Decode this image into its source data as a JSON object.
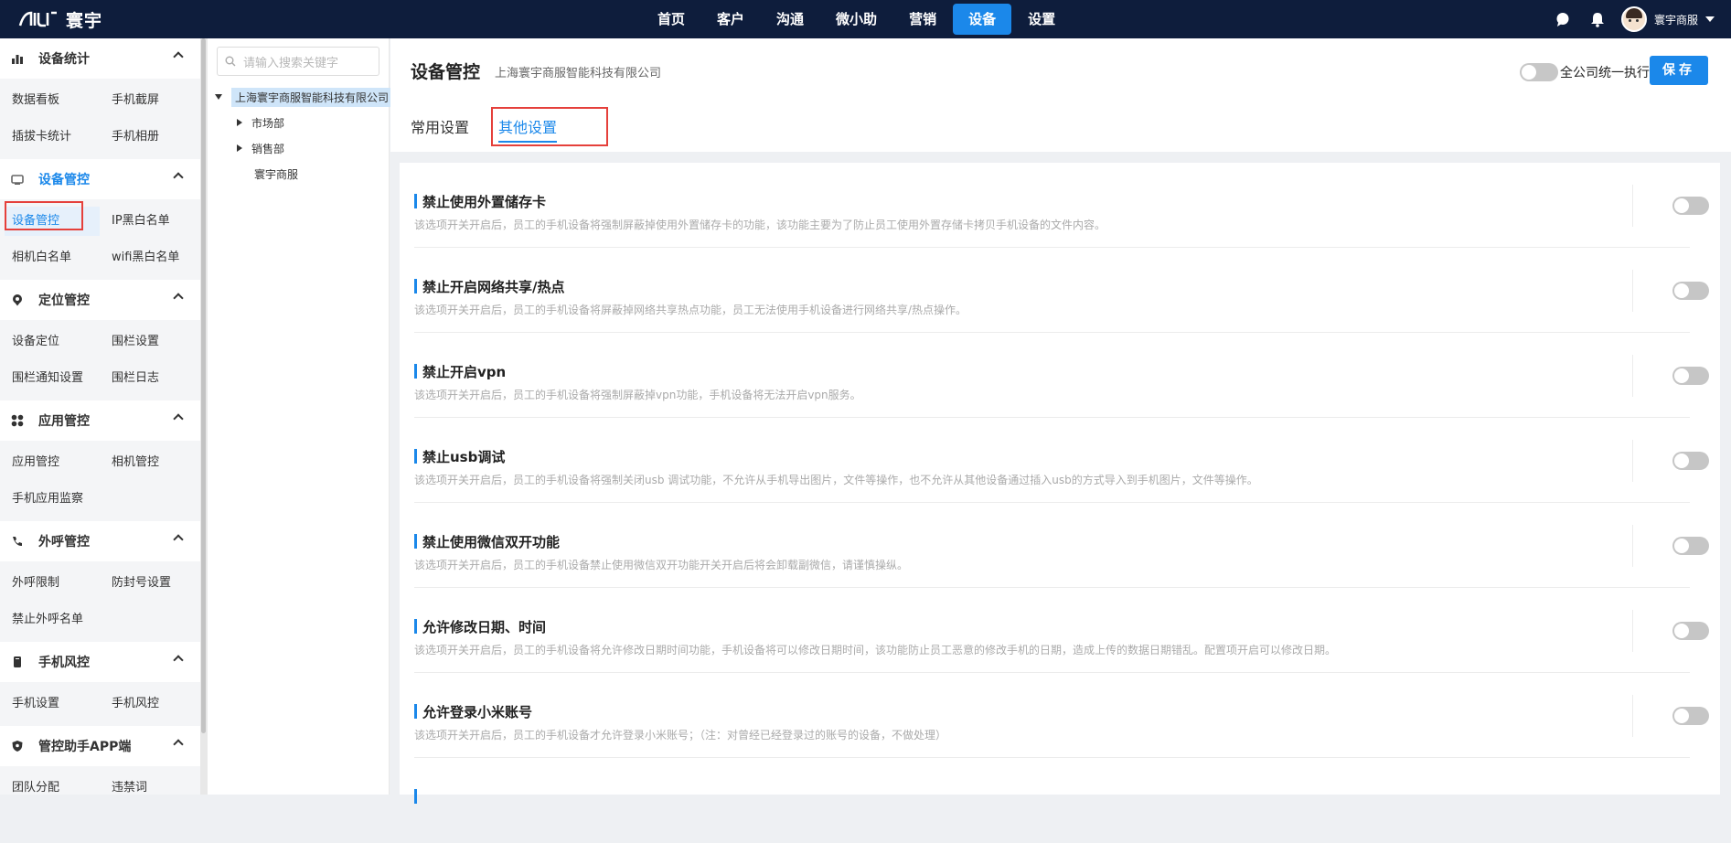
{
  "brand": {
    "name": "寰宇"
  },
  "topnav": [
    {
      "label": "首页"
    },
    {
      "label": "客户"
    },
    {
      "label": "沟通"
    },
    {
      "label": "微小助"
    },
    {
      "label": "营销"
    },
    {
      "label": "设备",
      "active": true
    },
    {
      "label": "设置"
    }
  ],
  "user": {
    "name": "寰宇商服"
  },
  "sidebar": {
    "sections": [
      {
        "title": "设备统计",
        "icon": "bar-chart-icon",
        "items": [
          "数据看板",
          "手机截屏",
          "插拔卡统计",
          "手机相册"
        ]
      },
      {
        "title": "设备管控",
        "icon": "device-icon",
        "items": [
          "设备管控",
          "IP黑白名单",
          "相机白名单",
          "wifi黑白名单"
        ]
      },
      {
        "title": "定位管控",
        "icon": "location-pin-icon",
        "items": [
          "设备定位",
          "围栏设置",
          "围栏通知设置",
          "围栏日志"
        ]
      },
      {
        "title": "应用管控",
        "icon": "apps-grid-icon",
        "items": [
          "应用管控",
          "相机管控",
          "手机应用监察"
        ]
      },
      {
        "title": "外呼管控",
        "icon": "phone-icon",
        "items": [
          "外呼限制",
          "防封号设置",
          "禁止外呼名单"
        ]
      },
      {
        "title": "手机风控",
        "icon": "mobile-icon",
        "items": [
          "手机设置",
          "手机风控"
        ]
      },
      {
        "title": "管控助手APP端",
        "icon": "shield-icon",
        "items": [
          "团队分配",
          "违禁词"
        ]
      }
    ]
  },
  "tree": {
    "search_placeholder": "请输入搜索关键字",
    "root": "上海寰宇商服智能科技有限公司",
    "children": [
      "市场部",
      "销售部",
      "寰宇商服"
    ]
  },
  "main": {
    "title": "设备管控",
    "company": "上海寰宇商服智能科技有限公司",
    "global_toggle_label": "全公司统一执行",
    "save_label": "保存",
    "tabs": [
      "常用设置",
      "其他设置"
    ],
    "active_tab": 1,
    "settings": [
      {
        "title": "禁止使用外置储存卡",
        "desc": "该选项开关开启后，员工的手机设备将强制屏蔽掉使用外置储存卡的功能，该功能主要为了防止员工使用外置存储卡拷贝手机设备的文件内容。",
        "enabled": false
      },
      {
        "title": "禁止开启网络共享/热点",
        "desc": "该选项开关开启后，员工的手机设备将屏蔽掉网络共享热点功能，员工无法使用手机设备进行网络共享/热点操作。",
        "enabled": false
      },
      {
        "title": "禁止开启vpn",
        "desc": "该选项开关开启后，员工的手机设备将强制屏蔽掉vpn功能，手机设备将无法开启vpn服务。",
        "enabled": false
      },
      {
        "title": "禁止usb调试",
        "desc": "该选项开关开启后，员工的手机设备将强制关闭usb 调试功能，不允许从手机导出图片，文件等操作，也不允许从其他设备通过插入usb的方式导入到手机图片，文件等操作。",
        "enabled": false
      },
      {
        "title": "禁止使用微信双开功能",
        "desc": "该选项开关开启后，员工的手机设备禁止使用微信双开功能开关开启后将会卸载副微信，请谨慎操纵。",
        "enabled": false
      },
      {
        "title": "允许修改日期、时间",
        "desc": "该选项开关开启后，员工的手机设备将允许修改日期时间功能，手机设备将可以修改日期时间，该功能防止员工恶意的修改手机的日期，造成上传的数据日期错乱。配置项开启可以修改日期。",
        "enabled": false
      },
      {
        "title": "允许登录小米账号",
        "desc": "该选项开关开启后，员工的手机设备才允许登录小米账号；（注：对曾经已经登录过的账号的设备，不做处理）",
        "enabled": false
      }
    ]
  },
  "colors": {
    "topbar": "#0e1d3c",
    "accent": "#1b88ea",
    "highlight_box": "#e5403b"
  }
}
